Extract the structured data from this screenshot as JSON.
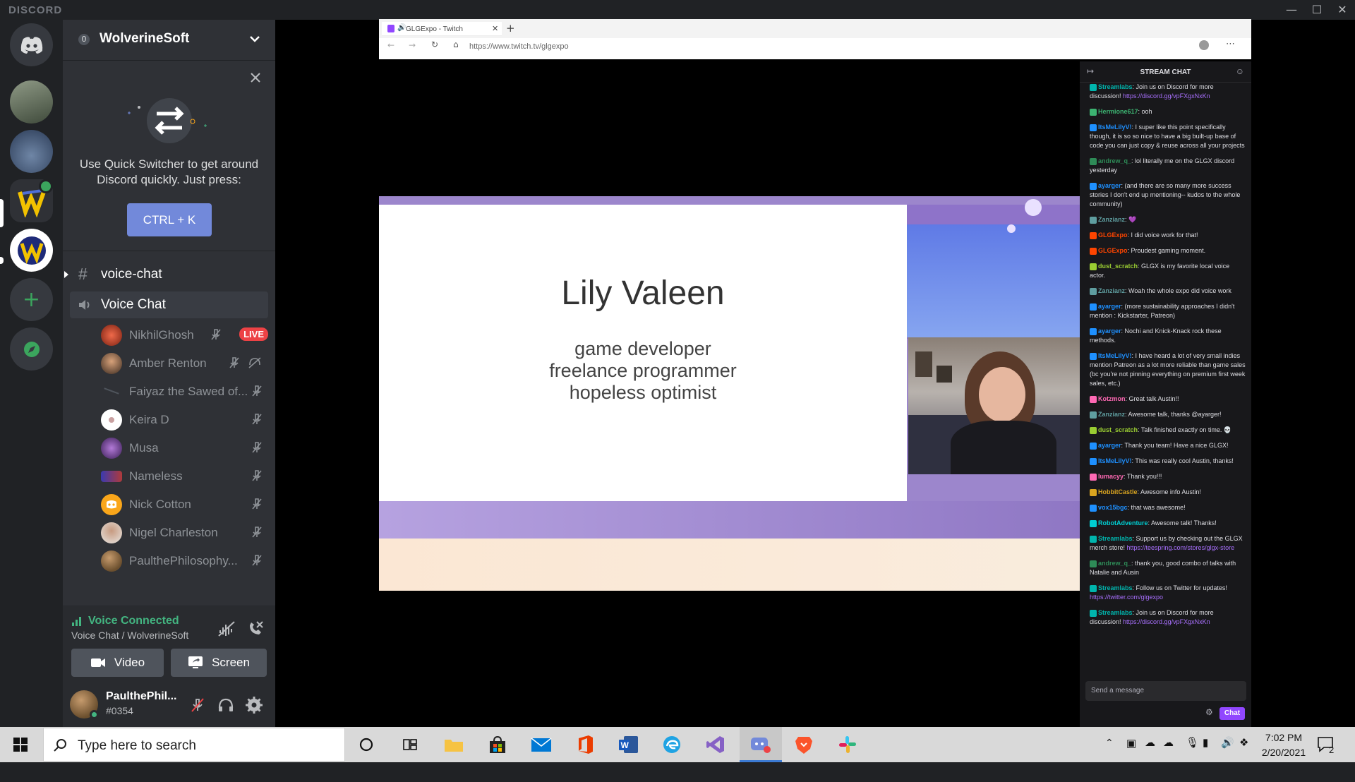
{
  "titlebar": {
    "brand": "DISCORD"
  },
  "server": {
    "name": "WolverineSoft",
    "badge": "0"
  },
  "quick_switcher": {
    "text": "Use Quick Switcher to get around Discord quickly. Just press:",
    "shortcut": "CTRL + K"
  },
  "channels": {
    "text_channel": "voice-chat",
    "voice_channel": "Voice Chat"
  },
  "voice_users": [
    {
      "name": "NikhilGhosh",
      "live": "LIVE"
    },
    {
      "name": "Amber Renton"
    },
    {
      "name": "Faiyaz the Sawed of..."
    },
    {
      "name": "Keira D"
    },
    {
      "name": "Musa"
    },
    {
      "name": "Nameless"
    },
    {
      "name": "Nick Cotton"
    },
    {
      "name": "Nigel Charleston"
    },
    {
      "name": "PaulthePhilosophy..."
    }
  ],
  "voice_panel": {
    "status": "Voice Connected",
    "location": "Voice Chat / WolverineSoft",
    "video_label": "Video",
    "screen_label": "Screen"
  },
  "user": {
    "name": "PaulthePhil...",
    "tag": "#0354"
  },
  "browser": {
    "tab_title": "GLGExpo - Twitch",
    "url": "https://www.twitch.tv/glgexpo"
  },
  "slide": {
    "title": "Lily Valeen",
    "subtitle_lines": [
      "game developer",
      "freelance programmer",
      "hopeless optimist"
    ]
  },
  "stream_chat": {
    "header": "STREAM CHAT",
    "messages": [
      {
        "user": "Streamlabs",
        "color": "#00b5ad",
        "text": ": Join us on Discord for more discussion! ",
        "link": "https://discord.gg/vpFXgxNxKn"
      },
      {
        "user": "Hermione617",
        "color": "#3cb371",
        "text": ": ooh"
      },
      {
        "user": "ItsMeLilyV!",
        "color": "#1e90ff",
        "text": ": I super like this point specifically though, it is so so nice to have a big built-up base of code you can just copy & reuse across all your projects"
      },
      {
        "user": "andrew_q_",
        "color": "#2e8b57",
        "text": ": lol literally me on the GLGX discord yesterday"
      },
      {
        "user": "ayarger",
        "color": "#1e90ff",
        "text": ": (and there are so many more success stories I don't end up mentioning-- kudos to the whole community)"
      },
      {
        "user": "Zanzianz",
        "color": "#5f9ea0",
        "text": ": 💜"
      },
      {
        "user": "GLGExpo",
        "color": "#ff4500",
        "text": ": I did voice work for that!"
      },
      {
        "user": "GLGExpo",
        "color": "#ff4500",
        "text": ": Proudest gaming moment."
      },
      {
        "user": "dust_scratch",
        "color": "#9acd32",
        "text": ": GLGX is my favorite local voice actor."
      },
      {
        "user": "Zanzianz",
        "color": "#5f9ea0",
        "text": ": Woah the whole expo did voice work"
      },
      {
        "user": "ayarger",
        "color": "#1e90ff",
        "text": ": (more sustainability approaches I didn't mention : Kickstarter, Patreon)"
      },
      {
        "user": "ayarger",
        "color": "#1e90ff",
        "text": ": Nochi and Knick-Knack rock these methods."
      },
      {
        "user": "ItsMeLilyV!",
        "color": "#1e90ff",
        "text": ": I have heard a lot of very small indies mention Patreon as a lot more reliable than game sales (bc you're not pinning everything on premium first week sales, etc.)"
      },
      {
        "user": "Kotzmon",
        "color": "#ff69b4",
        "text": ": Great talk Austin!!"
      },
      {
        "user": "Zanzianz",
        "color": "#5f9ea0",
        "text": ": Awesome talk, thanks @ayarger!"
      },
      {
        "user": "dust_scratch",
        "color": "#9acd32",
        "text": ": Talk finished exactly on time. 💀"
      },
      {
        "user": "ayarger",
        "color": "#1e90ff",
        "text": ": Thank you team! Have a nice GLGX!"
      },
      {
        "user": "ItsMeLilyV!",
        "color": "#1e90ff",
        "text": ": This was really cool Austin, thanks!"
      },
      {
        "user": "lumacyy",
        "color": "#ff69b4",
        "text": ": Thank you!!!"
      },
      {
        "user": "HobbitCastle",
        "color": "#daa520",
        "text": ": Awesome info Austin!"
      },
      {
        "user": "vox15bgc",
        "color": "#1e90ff",
        "text": ": that was awesome!"
      },
      {
        "user": "RobotAdventure",
        "color": "#00ced1",
        "text": ": Awesome talk! Thanks!"
      },
      {
        "user": "Streamlabs",
        "color": "#00b5ad",
        "text": ": Support us by checking out the GLGX merch store! ",
        "link": "https://teespring.com/stores/glgx-store"
      },
      {
        "user": "andrew_q_",
        "color": "#2e8b57",
        "text": ": thank you, good combo of talks with Natalie and Ausin"
      },
      {
        "user": "Streamlabs",
        "color": "#00b5ad",
        "text": ": Follow us on Twitter for updates! ",
        "link": "https://twitter.com/glgexpo"
      },
      {
        "user": "Streamlabs",
        "color": "#00b5ad",
        "text": ": Join us on Discord for more discussion! ",
        "link": "https://discord.gg/vpFXgxNxKn"
      }
    ],
    "input_placeholder": "Send a message",
    "send_label": "Chat"
  },
  "taskbar": {
    "search_placeholder": "Type here to search",
    "time": "7:02 PM",
    "date": "2/20/2021",
    "notification_count": "2"
  },
  "colors": {
    "blurple": "#7289da",
    "green": "#43b581",
    "live_red": "#ed4245",
    "twitch_purple": "#9147ff"
  }
}
